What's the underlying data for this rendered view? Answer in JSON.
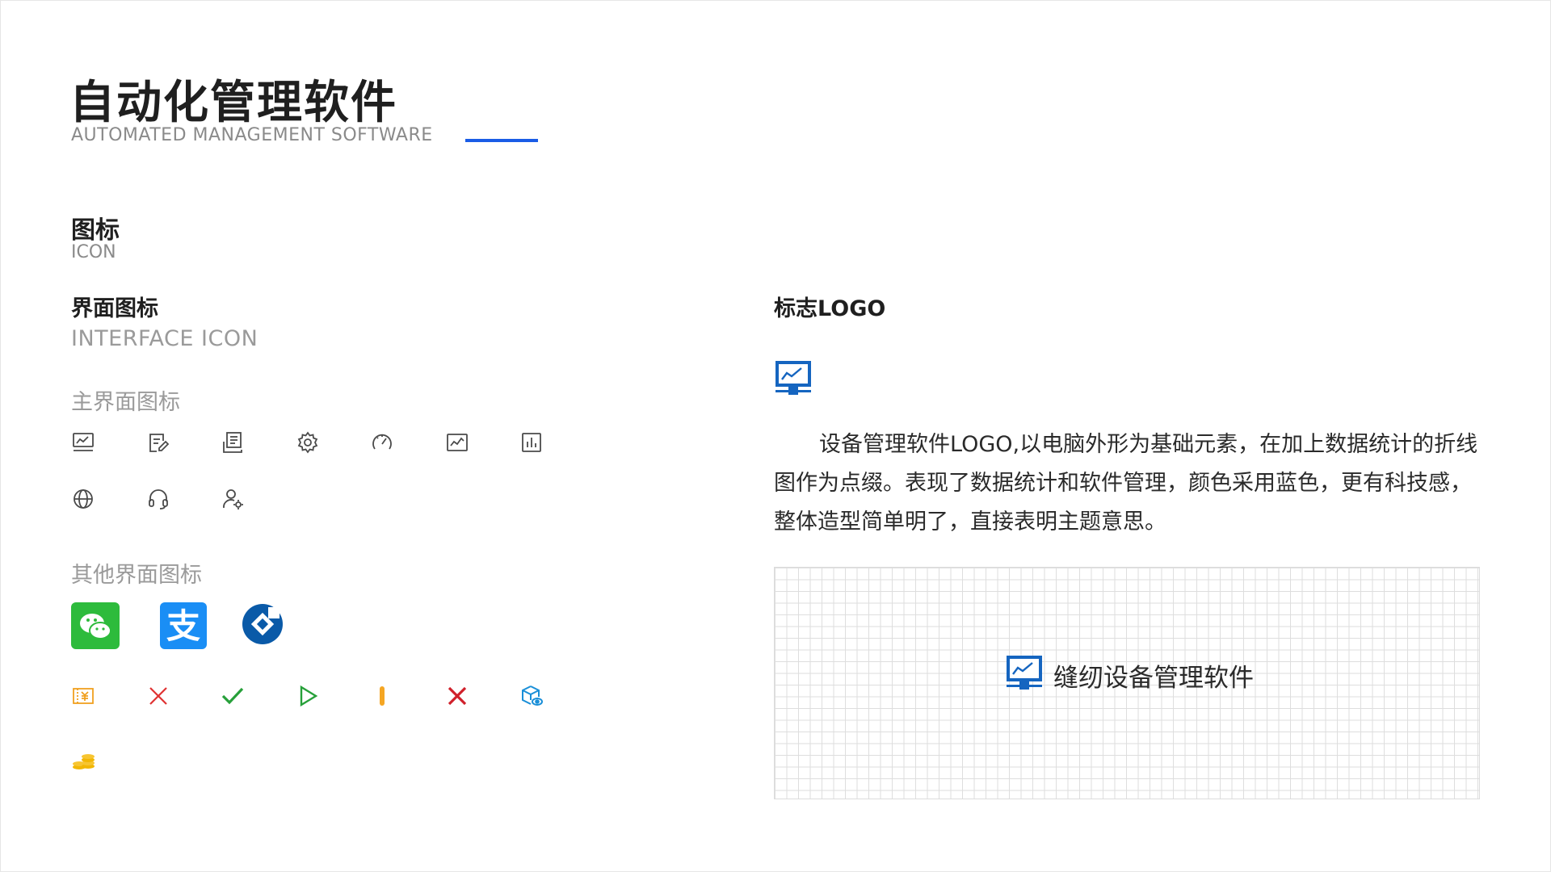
{
  "header": {
    "title": "自动化管理软件",
    "subtitle": "AUTOMATED MANAGEMENT SOFTWARE",
    "accent_color": "#1a5ce6"
  },
  "icon_section": {
    "title": "图标",
    "subtitle": "ICON"
  },
  "interface_section": {
    "title": "界面图标",
    "subtitle": "INTERFACE ICON",
    "main_group_label": "主界面图标",
    "main_icons": [
      "monitor-chart-icon",
      "edit-document-icon",
      "report-list-icon",
      "gear-icon",
      "gauge-icon",
      "line-chart-icon",
      "bar-chart-icon",
      "globe-icon",
      "headset-icon",
      "user-settings-icon"
    ],
    "other_group_label": "其他界面图标",
    "app_icons": [
      "wechat-icon",
      "alipay-icon",
      "ccb-bank-icon"
    ],
    "status_icons": [
      "yuan-ticket-icon",
      "close-red-icon",
      "check-green-icon",
      "play-green-icon",
      "warning-bar-icon",
      "cross-red-icon",
      "cube-eye-icon",
      "coin-stack-icon"
    ],
    "alipay_glyph": "支"
  },
  "logo_section": {
    "title": "标志LOGO",
    "description": "设备管理软件LOGO,以电脑外形为基础元素，在加上数据统计的折线图作为点缀。表现了数据统计和软件管理，颜色采用蓝色，更有科技感，整体造型简单明了，直接表明主题意思。",
    "grid_text": "缝纫设备管理软件",
    "logo_color": "#1565c0"
  }
}
